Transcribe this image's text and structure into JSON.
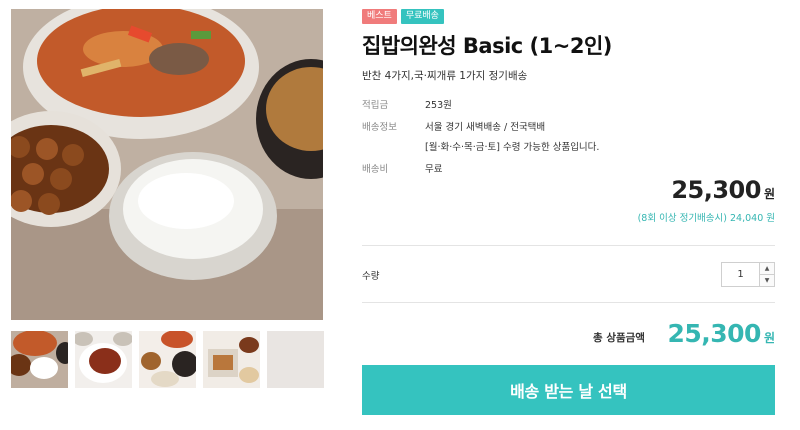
{
  "product": {
    "badges": {
      "best": "베스트",
      "free_shipping": "무료배송"
    },
    "title": "집밥의완성 Basic (1~2인)",
    "subtitle": "반찬 4가지,국·찌개류 1가지 정기배송",
    "info": {
      "points_label": "적립금",
      "points_value": "253원",
      "delivery_label": "배송정보",
      "delivery_value_1": "서울 경기 새벽배송 / 전국택배",
      "delivery_value_2": "[월·화·수·목·금·토] 수령 가능한 상품입니다.",
      "fee_label": "배송비",
      "fee_value": "무료"
    },
    "price": {
      "amount": "25,300",
      "unit": "원"
    },
    "subscription_price": "(8회 이상 정기배송시) 24,040 원",
    "quantity": {
      "label": "수량",
      "value": "1",
      "up_icon": "▲",
      "down_icon": "▼"
    },
    "total": {
      "label": "총 상품금액",
      "amount": "25,300",
      "unit": "원"
    },
    "cta_label": "배송 받는 날 선택"
  },
  "colors": {
    "accent": "#35c3bf",
    "accent_text": "#35b6b2",
    "badge_best": "#f07b7b",
    "badge_free": "#35c3bf"
  },
  "icons": {
    "qty_up": "triangle-up-icon",
    "qty_down": "triangle-down-icon"
  }
}
